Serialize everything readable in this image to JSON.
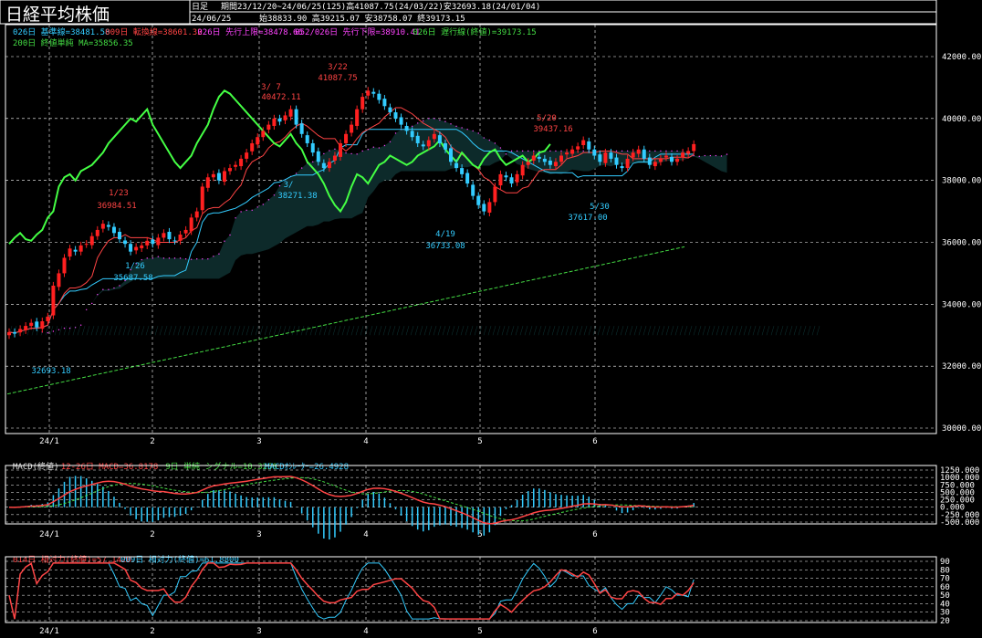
{
  "header": {
    "title": "日経平均株価",
    "bar_type": "日足",
    "period_info": "期間23/12/20~24/06/25(125)高41087.75(24/03/22)安32693.18(24/01/04)",
    "date": "24/06/25",
    "ohlc": "始38833.90 高39215.07 安38758.07 終39173.15"
  },
  "legend_main": [
    {
      "text": "026日 基準線=38481.58",
      "color": "#33ccff"
    },
    {
      "text": "009日 転換線=38601.32",
      "color": "#ff4444"
    },
    {
      "text": "026日 先行上限=38478.66",
      "color": "#ff44ff"
    },
    {
      "text": "052/026日 先行下限=38910.41",
      "color": "#ff44ff"
    },
    {
      "text": "026日 遅行線(終値)=39173.15",
      "color": "#44dd44"
    },
    {
      "text": "200日 終値単純 MA=35856.35",
      "color": "#44dd44"
    }
  ],
  "legend_macd": [
    {
      "text": "MACD(終値)",
      "color": "#dddddd"
    },
    {
      "text": "12-26日 MACD=36.8178",
      "color": "#ff4444"
    },
    {
      "text": "9日 単純 シグナル=10.3250",
      "color": "#44dd44"
    },
    {
      "text": "MACDｵｼﾚｰﾀｰ=26.4928",
      "color": "#33ccff"
    }
  ],
  "legend_rsi": [
    {
      "text": "014日 相対力(終値)=57.1420",
      "color": "#ff4444"
    },
    {
      "text": "009日 相対力(終値)=61.8800",
      "color": "#33ccff"
    }
  ],
  "x_tick_labels": [
    "24/1",
    "2",
    "3",
    "4",
    "5",
    "6"
  ],
  "annotations": [
    {
      "text": "1/23",
      "color": "#ff4444"
    },
    {
      "text": "36984.51",
      "color": "#ff4444"
    },
    {
      "text": "1/26",
      "color": "#33ccff"
    },
    {
      "text": "35687.58",
      "color": "#33ccff"
    },
    {
      "text": "3/ 7",
      "color": "#ff4444"
    },
    {
      "text": "40472.11",
      "color": "#ff4444"
    },
    {
      "text": "3/22",
      "color": "#ff4444"
    },
    {
      "text": "41087.75",
      "color": "#ff4444"
    },
    {
      "text": "3/",
      "color": "#33ccff"
    },
    {
      "text": "38271.38",
      "color": "#33ccff"
    },
    {
      "text": "4/19",
      "color": "#33ccff"
    },
    {
      "text": "36733.08",
      "color": "#33ccff"
    },
    {
      "text": "5/20",
      "color": "#ff4444"
    },
    {
      "text": "39437.16",
      "color": "#ff4444"
    },
    {
      "text": "5/30",
      "color": "#33ccff"
    },
    {
      "text": "37617.00",
      "color": "#33ccff"
    },
    {
      "text": "32693.18",
      "color": "#33ccff"
    }
  ],
  "chart_data": [
    {
      "type": "candlestick",
      "title": "日経平均株価",
      "ylim": [
        30000,
        42500
      ],
      "y_ticks": [
        "42000.00",
        "40000.00",
        "38000.00",
        "36000.00",
        "34000.00",
        "32000.00",
        "30000.00"
      ],
      "y_tick_values": [
        42000,
        40000,
        38000,
        36000,
        34000,
        32000,
        30000
      ],
      "grid": true,
      "up_color": "#ff2020",
      "down_color": "#33ccff",
      "closes": [
        33100,
        33050,
        33200,
        33300,
        33400,
        33250,
        33450,
        33600,
        34600,
        35000,
        35500,
        35800,
        35700,
        35900,
        35950,
        36200,
        36400,
        36600,
        36500,
        36300,
        36100,
        35950,
        35700,
        35850,
        35900,
        36050,
        35950,
        36150,
        36300,
        36100,
        36050,
        36250,
        36400,
        36800,
        37000,
        37800,
        38100,
        38200,
        38000,
        38300,
        38400,
        38500,
        38700,
        38900,
        39200,
        39400,
        39600,
        39800,
        40000,
        39900,
        40100,
        40300,
        39800,
        39500,
        39200,
        38900,
        38600,
        38400,
        38600,
        38800,
        39200,
        39500,
        39800,
        40300,
        40700,
        40900,
        40800,
        40600,
        40400,
        40200,
        40000,
        39800,
        39600,
        39400,
        39200,
        39100,
        39300,
        39500,
        39200,
        39000,
        38600,
        38400,
        38200,
        37900,
        37500,
        37200,
        37000,
        37300,
        37800,
        38200,
        38100,
        37900,
        38200,
        38500,
        38600,
        38800,
        38700,
        38600,
        38500,
        38600,
        38800,
        38900,
        39000,
        39100,
        39300,
        39000,
        38800,
        38600,
        38900,
        38700,
        38500,
        38400,
        38700,
        38900,
        39000,
        38700,
        38500,
        38600,
        38700,
        38800,
        38600,
        38700,
        38900,
        38950,
        39173
      ],
      "ichimoku": {
        "kijun_final": 38481.58,
        "tenkan_final": 38601.32,
        "senkou_a_final": 38478.66,
        "senkou_b_final": 38910.41,
        "chikou_final": 39173.15
      },
      "ma200": {
        "start": 31100,
        "end": 35856.35
      },
      "labels": [
        "24/1",
        "2",
        "3",
        "4",
        "5",
        "6"
      ]
    },
    {
      "type": "line",
      "title": "MACD(終値)",
      "ylim": [
        -500,
        1250
      ],
      "y_ticks": [
        "1250.000",
        "1000.000",
        "750.000",
        "500.000",
        "250.000",
        "0.000",
        "-250.000",
        "-500.000"
      ],
      "y_tick_values": [
        1250,
        1000,
        750,
        500,
        250,
        0,
        -250,
        -500
      ],
      "series": [
        {
          "name": "12-26日 MACD",
          "color": "#ff4444",
          "final": 36.8178
        },
        {
          "name": "9日 単純 シグナル",
          "color": "#44dd44",
          "final": 10.325
        },
        {
          "name": "MACDｵｼﾚｰﾀｰ",
          "color": "#33ccff",
          "final": 26.4928
        }
      ]
    },
    {
      "type": "line",
      "title": "相対力",
      "ylim": [
        20,
        90
      ],
      "y_ticks": [
        "90",
        "80",
        "70",
        "60",
        "50",
        "40",
        "30",
        "20"
      ],
      "y_tick_values": [
        90,
        80,
        70,
        60,
        50,
        40,
        30,
        20
      ],
      "series": [
        {
          "name": "014日 相対力(終値)",
          "color": "#ff4444",
          "final": 57.142
        },
        {
          "name": "009日 相対力(終値)",
          "color": "#33ccff",
          "final": 61.88
        }
      ]
    }
  ]
}
